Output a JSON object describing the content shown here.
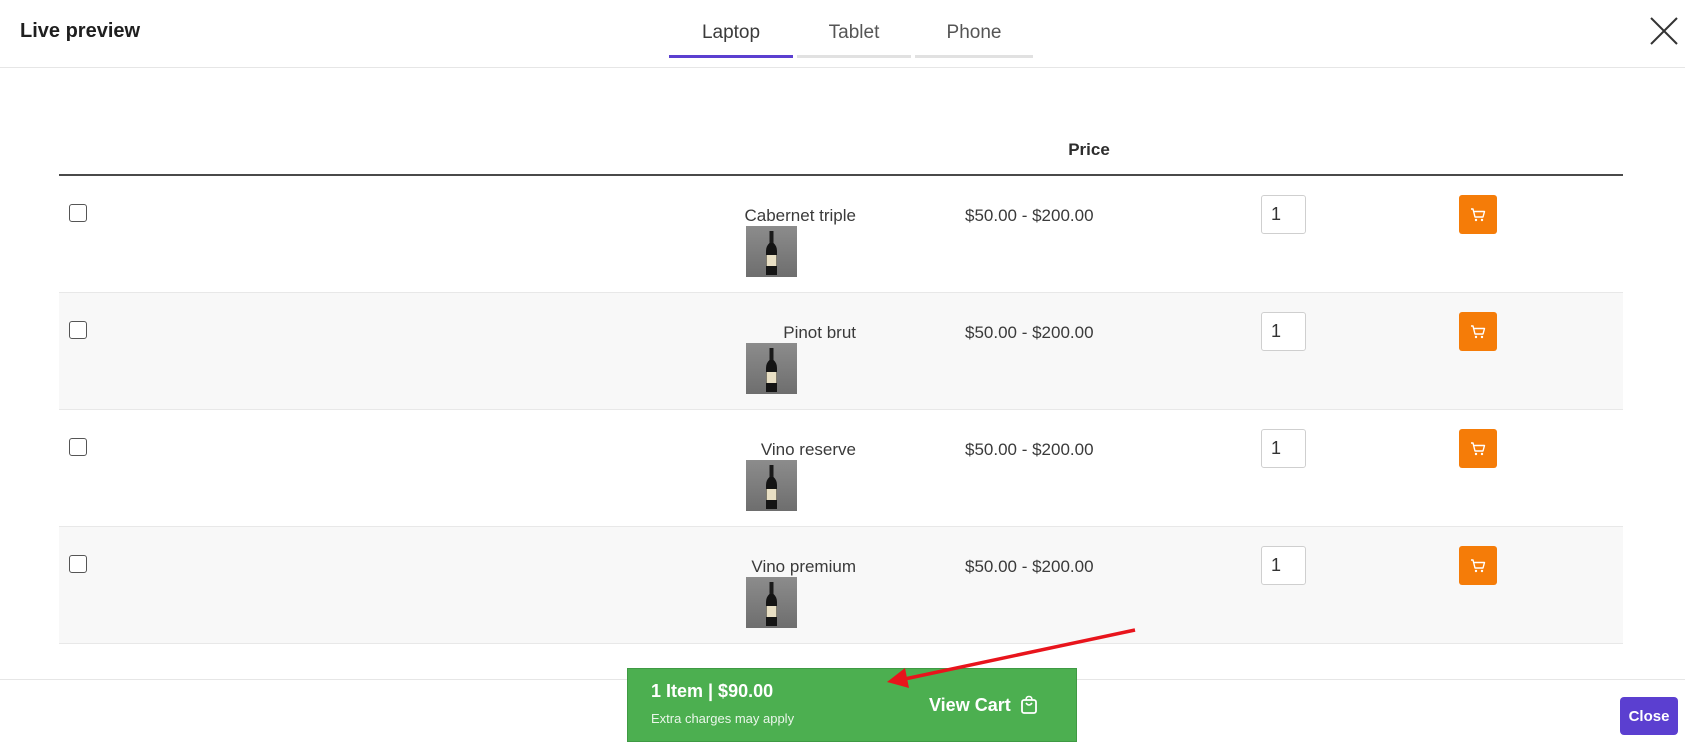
{
  "header": {
    "title": "Live preview",
    "tabs": [
      {
        "label": "Laptop",
        "active": true
      },
      {
        "label": "Tablet",
        "active": false
      },
      {
        "label": "Phone",
        "active": false
      }
    ]
  },
  "table": {
    "price_header": "Price",
    "rows": [
      {
        "name": "Cabernet triple",
        "price": "$50.00 - $200.00",
        "qty": "1"
      },
      {
        "name": "Pinot brut",
        "price": "$50.00 - $200.00",
        "qty": "1"
      },
      {
        "name": "Vino reserve",
        "price": "$50.00 - $200.00",
        "qty": "1"
      },
      {
        "name": "Vino premium",
        "price": "$50.00 - $200.00",
        "qty": "1"
      }
    ]
  },
  "cart_bar": {
    "summary": "1 Item | $90.00",
    "note": "Extra charges may apply",
    "view_label": "View Cart"
  },
  "footer": {
    "close_label": "Close"
  },
  "colors": {
    "accent": "#5b3fd0",
    "cart_button": "#f57c08",
    "cart_bar": "#4caf50",
    "annotation_arrow": "#e8141c"
  },
  "icons": {
    "close": "close-x-icon",
    "cart": "shopping-cart-icon",
    "bag": "shopping-bag-icon"
  }
}
